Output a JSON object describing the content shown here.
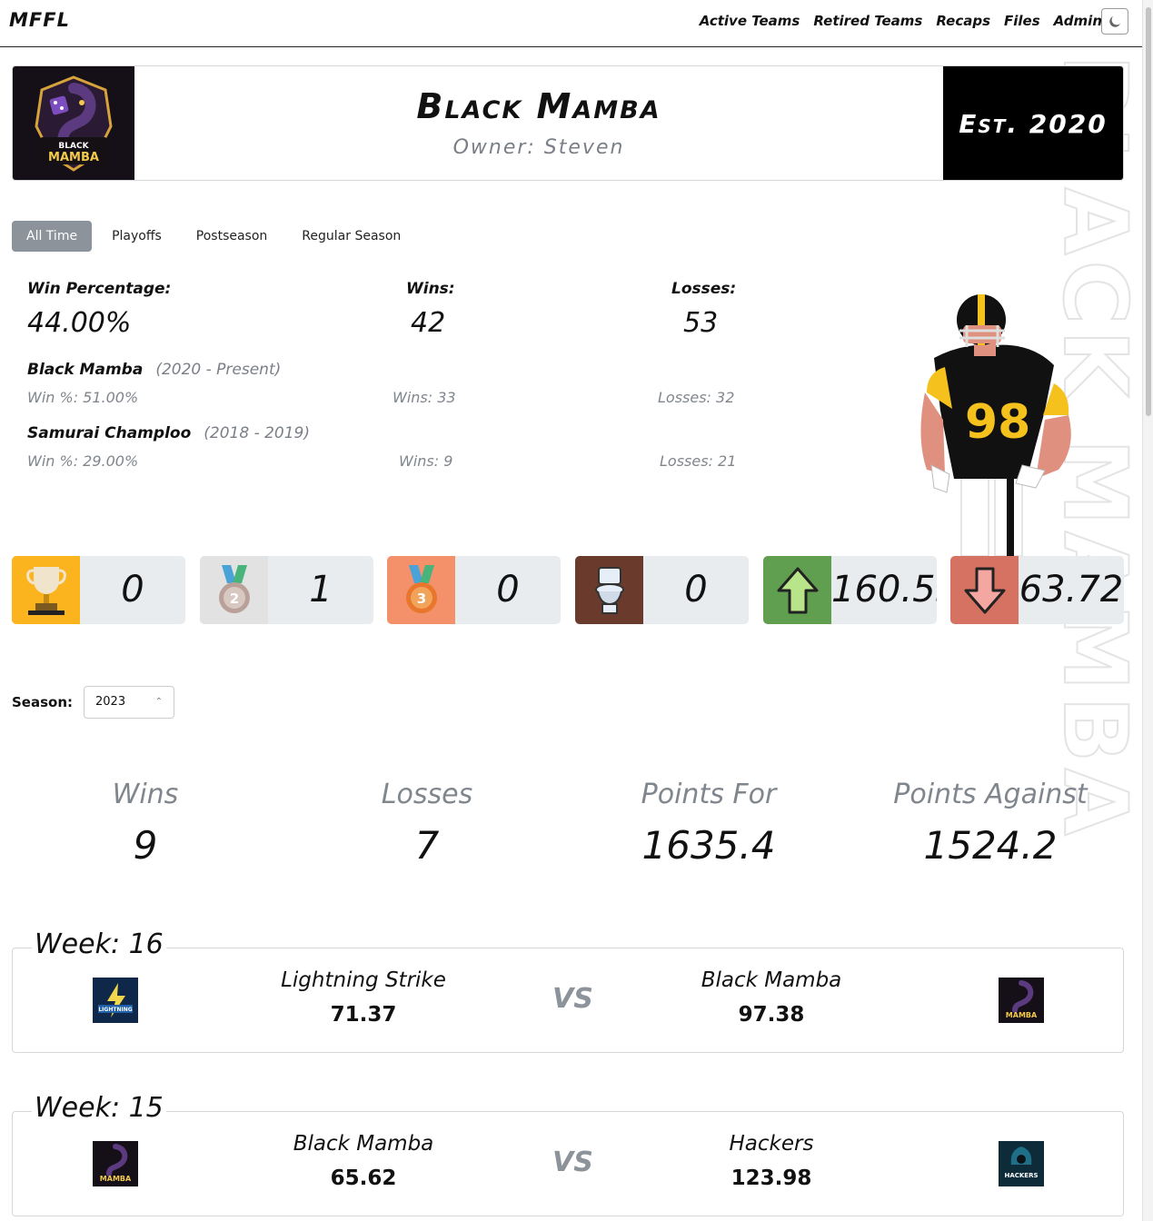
{
  "nav": {
    "brand": "MFFL",
    "links": [
      "Active Teams",
      "Retired Teams",
      "Recaps",
      "Files",
      "Admin"
    ],
    "theme_icon": "moon-icon"
  },
  "watermark": {
    "text": "BLACK MAMBA"
  },
  "team": {
    "name": "Black Mamba",
    "owner": "Owner: Steven",
    "established": "Est. 2020",
    "logo_text_1": "BLACK",
    "logo_text_2": "MAMBA"
  },
  "tabs": [
    "All Time",
    "Playoffs",
    "Postseason",
    "Regular Season"
  ],
  "active_tab": "All Time",
  "overall": {
    "win_pct_label": "Win Percentage:",
    "win_pct": "44.00%",
    "wins_label": "Wins:",
    "wins": "42",
    "losses_label": "Losses:",
    "losses": "53"
  },
  "history": [
    {
      "name": "Black Mamba",
      "years": "(2020 - Present)",
      "win_pct": "Win %: 51.00%",
      "wins": "Wins: 33",
      "losses": "Losses: 32"
    },
    {
      "name": "Samurai Champloo",
      "years": "(2018 - 2019)",
      "win_pct": "Win %: 29.00%",
      "wins": "Wins: 9",
      "losses": "Losses: 21"
    }
  ],
  "player_jersey_number": "98",
  "awards": [
    {
      "icon": "trophy-icon",
      "value": "0",
      "color": "#fbb41d"
    },
    {
      "icon": "silver-medal-icon",
      "value": "1",
      "color": "#e2e2e2"
    },
    {
      "icon": "bronze-medal-icon",
      "value": "0",
      "color": "#f4916a"
    },
    {
      "icon": "toilet-icon",
      "value": "0",
      "color": "#6a3b2c"
    },
    {
      "icon": "arrow-up-icon",
      "value": "160.55",
      "color": "#5f9f4f"
    },
    {
      "icon": "arrow-down-icon",
      "value": "63.72",
      "color": "#d67262"
    }
  ],
  "season": {
    "label": "Season:",
    "value": "2023"
  },
  "season_totals": [
    {
      "label": "Wins",
      "value": "9"
    },
    {
      "label": "Losses",
      "value": "7"
    },
    {
      "label": "Points For",
      "value": "1635.4"
    },
    {
      "label": "Points Against",
      "value": "1524.2"
    }
  ],
  "matchups": [
    {
      "week": "Week: 16",
      "home_name": "Lightning Strike",
      "home_score": "71.37",
      "away_name": "Black Mamba",
      "away_score": "97.38",
      "vs": "VS",
      "home_logo_text": "LIGHTNING",
      "away_logo_text": "MAMBA"
    },
    {
      "week": "Week: 15",
      "home_name": "Black Mamba",
      "home_score": "65.62",
      "away_name": "Hackers",
      "away_score": "123.98",
      "vs": "VS",
      "home_logo_text": "MAMBA",
      "away_logo_text": "HACKERS"
    }
  ]
}
